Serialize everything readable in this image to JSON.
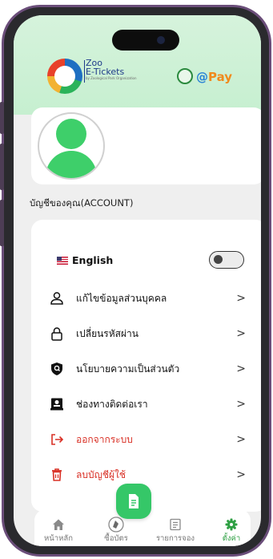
{
  "header": {
    "logo_title_line1": "Zoo",
    "logo_title_line2": "E-Tickets",
    "logo_subtitle": "by Zoological Park Organization",
    "pay_prefix": "@",
    "pay_word": "Pay"
  },
  "account": {
    "section_title": "บัญชีของคุณ(ACCOUNT)"
  },
  "settings": {
    "language_label": "English",
    "language_toggle_on": false,
    "items": [
      {
        "label": "แก้ไขข้อมูลส่วนบุคคล",
        "icon": "person-icon",
        "chevron": ">"
      },
      {
        "label": "เปลี่ยนรหัสผ่าน",
        "icon": "lock-icon",
        "chevron": ">"
      },
      {
        "label": "นโยบายความเป็นส่วนตัว",
        "icon": "shield-icon",
        "chevron": ">"
      },
      {
        "label": "ช่องทางติดต่อเรา",
        "icon": "contact-card-icon",
        "chevron": ">"
      },
      {
        "label": "ออกจากระบบ",
        "icon": "logout-icon",
        "chevron": ">",
        "danger": true
      },
      {
        "label": "ลบบัญชีผู้ใช้",
        "icon": "trash-icon",
        "chevron": ">",
        "danger": true
      }
    ]
  },
  "bottom_nav": {
    "items": [
      {
        "label": "หน้าหลัก",
        "icon": "home-icon",
        "active": false
      },
      {
        "label": "ซื้อบัตร",
        "icon": "ticket-icon",
        "active": false
      },
      {
        "label": "รายการจอง",
        "icon": "list-icon",
        "active": false
      },
      {
        "label": "ตั้งค่า",
        "icon": "gear-icon",
        "active": true
      }
    ],
    "fab_icon": "document-icon"
  },
  "colors": {
    "accent_green": "#35c768",
    "danger_red": "#d93025",
    "header_bg": "#d6f3dc",
    "frame": "#6b4e7a"
  }
}
